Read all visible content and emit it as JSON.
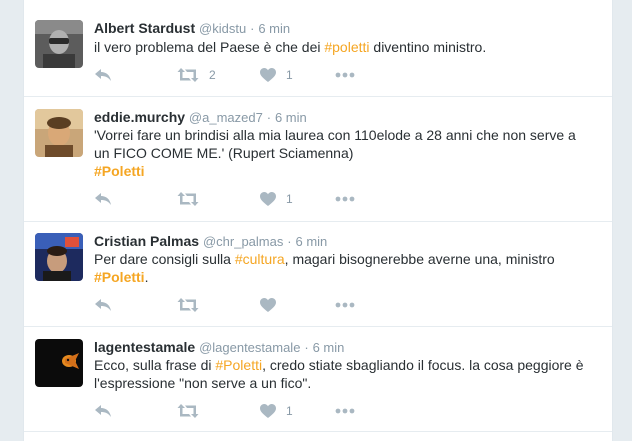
{
  "tweets": [
    {
      "fullname": "Albert Stardust",
      "handle": "@kidstu",
      "separator": "·",
      "time": "6 min",
      "text": {
        "before": "il vero problema del Paese è che dei ",
        "hashtag": "#poletti",
        "after": " diventino ministro."
      },
      "retweets": "2",
      "likes": "1"
    },
    {
      "fullname": "eddie.murchy",
      "handle": "@a_mazed7",
      "separator": "·",
      "time": "6 min",
      "text": {
        "line1": "'Vorrei fare un brindisi alla mia laurea con 110elode a 28 anni che non serve a",
        "line2": "un FICO COME ME.' (Rupert Sciamenna)",
        "hashtag": "#Poletti"
      },
      "retweets": "",
      "likes": "1"
    },
    {
      "fullname": "Cristian Palmas",
      "handle": "@chr_palmas",
      "separator": "·",
      "time": "6 min",
      "text": {
        "before": "Per dare consigli sulla ",
        "hashtag1": "#cultura",
        "middle": ", magari bisognerebbe averne una, ministro",
        "hashtag2": "#Poletti",
        "after": "."
      },
      "retweets": "",
      "likes": ""
    },
    {
      "fullname": "lagentestamale",
      "handle": "@lagentestamale",
      "separator": "·",
      "time": "6 min",
      "text": {
        "before": "Ecco, sulla frase di ",
        "hashtag": "#Poletti",
        "after": ", credo stiate sbagliando il focus. la cosa peggiore è",
        "line2": "l'espressione \"non serve a un fico\"."
      },
      "retweets": "",
      "likes": "1"
    }
  ],
  "icons": {
    "reply": "reply-icon",
    "retweet": "retweet-icon",
    "like": "heart-icon",
    "more": "more-icon"
  },
  "colors": {
    "hashtag": "#f5a623",
    "text": "#292f33",
    "muted": "#8899a6",
    "icon": "#aab8c2"
  }
}
